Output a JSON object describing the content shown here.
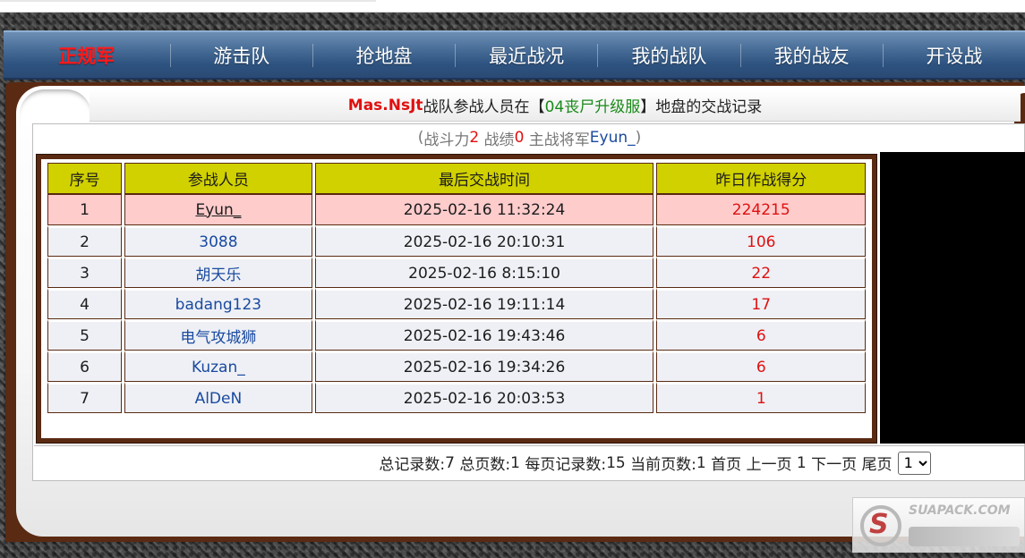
{
  "nav": {
    "items": [
      {
        "label": "正规军",
        "active": true
      },
      {
        "label": "游击队"
      },
      {
        "label": "抢地盘"
      },
      {
        "label": "最近战况"
      },
      {
        "label": "我的战队"
      },
      {
        "label": "我的战友"
      },
      {
        "label": "开设战"
      }
    ]
  },
  "title": {
    "team": "Mas.NsJt",
    "part1": "战队参战人员在",
    "bracket_open": "【",
    "server": "04丧尸升级服",
    "bracket_close": "】",
    "part2": "地盘的交战记录"
  },
  "stats": {
    "open": "(",
    "power_label": "战斗力",
    "power_value": "2",
    "record_label": "战绩",
    "record_value": "0",
    "general_label": "主战将军",
    "general_name": "Eyun_",
    "close": ")"
  },
  "table": {
    "headers": [
      "序号",
      "参战人员",
      "最后交战时间",
      "昨日作战得分"
    ],
    "rows": [
      {
        "no": "1",
        "name": "Eyun_",
        "time": "2025-02-16 11:32:24",
        "score": "224215"
      },
      {
        "no": "2",
        "name": "3088",
        "time": "2025-02-16 20:10:31",
        "score": "106"
      },
      {
        "no": "3",
        "name": "胡天乐",
        "time": "2025-02-16 8:15:10",
        "score": "22"
      },
      {
        "no": "4",
        "name": "badang123",
        "time": "2025-02-16 19:11:14",
        "score": "17"
      },
      {
        "no": "5",
        "name": "电气攻城狮",
        "time": "2025-02-16 19:43:46",
        "score": "6"
      },
      {
        "no": "6",
        "name": "Kuzan_",
        "time": "2025-02-16 19:34:26",
        "score": "6"
      },
      {
        "no": "7",
        "name": "AlDeN",
        "time": "2025-02-16 20:03:53",
        "score": "1"
      }
    ]
  },
  "pager": {
    "total_label": "总记录数:",
    "total_value": "7",
    "pages_label": "总页数:",
    "pages_value": "1",
    "per_page_label": "每页记录数:",
    "per_page_value": "15",
    "current_label": "当前页数:",
    "current_value": "1",
    "first": "首页",
    "prev": "上一页",
    "page_num": "1",
    "next": "下一页",
    "last": "尾页",
    "select_value": "1"
  },
  "watermark": {
    "text": "SUAPACK.COM"
  },
  "colors": {
    "nav_active": "#ff1a1a",
    "header_bg": "#d1d100",
    "highlight_row": "#ffcccc",
    "score": "#e01010",
    "name_link": "#1a4aa0",
    "frame": "#5a2a12"
  }
}
